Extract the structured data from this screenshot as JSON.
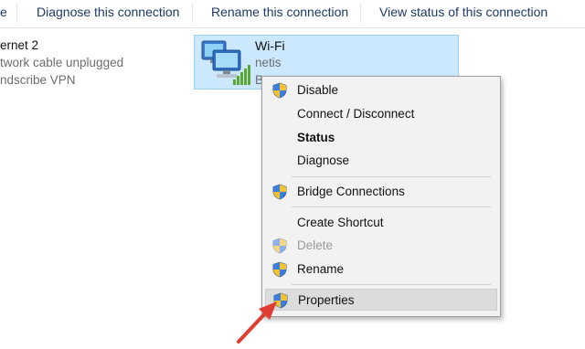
{
  "toolbar": {
    "cut_label": "e",
    "diagnose_label": "Diagnose this connection",
    "rename_label": "Rename this connection",
    "view_status_label": "View status of this connection"
  },
  "connections": {
    "left": {
      "name": "ernet 2",
      "status": "twork cable unplugged",
      "device": "ndscribe VPN"
    },
    "wifi": {
      "name": "Wi-Fi",
      "ssid": "netis",
      "extra": "B"
    }
  },
  "context_menu": {
    "items": [
      {
        "label": "Disable",
        "shield": true
      },
      {
        "label": "Connect / Disconnect",
        "shield": false
      },
      {
        "label": "Status",
        "shield": false,
        "bold": true
      },
      {
        "label": "Diagnose",
        "shield": false
      },
      {
        "label": "Bridge Connections",
        "shield": true
      },
      {
        "label": "Create Shortcut",
        "shield": false
      },
      {
        "label": "Delete",
        "shield": true,
        "disabled": true
      },
      {
        "label": "Rename",
        "shield": true
      },
      {
        "label": "Properties",
        "shield": true,
        "highlighted": true
      }
    ]
  },
  "colors": {
    "selection_fill": "#cce8ff",
    "selection_border": "#99d1ff",
    "menu_bg": "#f2f2f2",
    "menu_hover": "#dcdcdc",
    "annotation_arrow": "#e03c31",
    "toolbar_text": "#1e3a66",
    "signal_bars": "#5aa832"
  },
  "icons": {
    "wifi_adapter": "network-computers-with-signal-icon",
    "uac_shield": "uac-shield-icon",
    "pointer": "red-arrow-annotation"
  }
}
